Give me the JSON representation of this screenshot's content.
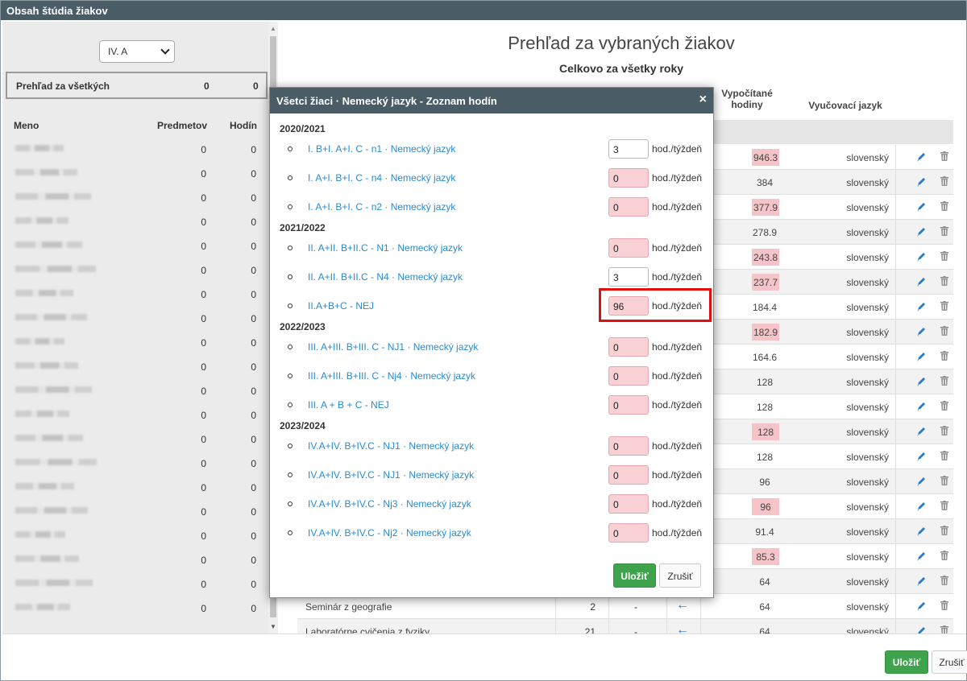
{
  "window": {
    "title": "Obsah štúdia žiakov"
  },
  "left": {
    "class_select": "IV. A",
    "overview_all": {
      "label": "Prehľad za všetkých",
      "subjects": "0",
      "hours": "0"
    },
    "headers": {
      "name": "Meno",
      "subjects": "Predmetov",
      "hours": "Hodín"
    },
    "rows": [
      {
        "subjects": "0",
        "hours": "0"
      },
      {
        "subjects": "0",
        "hours": "0"
      },
      {
        "subjects": "0",
        "hours": "0"
      },
      {
        "subjects": "0",
        "hours": "0"
      },
      {
        "subjects": "0",
        "hours": "0"
      },
      {
        "subjects": "0",
        "hours": "0"
      },
      {
        "subjects": "0",
        "hours": "0"
      },
      {
        "subjects": "0",
        "hours": "0"
      },
      {
        "subjects": "0",
        "hours": "0"
      },
      {
        "subjects": "0",
        "hours": "0"
      },
      {
        "subjects": "0",
        "hours": "0"
      },
      {
        "subjects": "0",
        "hours": "0"
      },
      {
        "subjects": "0",
        "hours": "0"
      },
      {
        "subjects": "0",
        "hours": "0"
      },
      {
        "subjects": "0",
        "hours": "0"
      },
      {
        "subjects": "0",
        "hours": "0"
      },
      {
        "subjects": "0",
        "hours": "0"
      },
      {
        "subjects": "0",
        "hours": "0"
      },
      {
        "subjects": "0",
        "hours": "0"
      },
      {
        "subjects": "0",
        "hours": "0"
      }
    ]
  },
  "main": {
    "title": "Prehľad za vybraných žiakov",
    "subtitle": "Celkovo za všetky roky",
    "headers": {
      "computed_hours": "Vypočítané hodiny",
      "language": "Vyučovací jazyk"
    },
    "rows": [
      {
        "hours": "946.3",
        "pink": true,
        "lang": "slovenský"
      },
      {
        "hours": "384",
        "pink": false,
        "lang": "slovenský"
      },
      {
        "hours": "377.9",
        "pink": true,
        "lang": "slovenský"
      },
      {
        "hours": "278.9",
        "pink": false,
        "lang": "slovenský"
      },
      {
        "hours": "243.8",
        "pink": true,
        "lang": "slovenský"
      },
      {
        "hours": "237.7",
        "pink": true,
        "lang": "slovenský"
      },
      {
        "hours": "184.4",
        "pink": false,
        "lang": "slovenský"
      },
      {
        "hours": "182.9",
        "pink": true,
        "lang": "slovenský"
      },
      {
        "hours": "164.6",
        "pink": false,
        "lang": "slovenský"
      },
      {
        "hours": "128",
        "pink": false,
        "lang": "slovenský"
      },
      {
        "hours": "128",
        "pink": false,
        "lang": "slovenský"
      },
      {
        "hours": "128",
        "pink": true,
        "lang": "slovenský"
      },
      {
        "hours": "128",
        "pink": false,
        "lang": "slovenský"
      },
      {
        "hours": "96",
        "pink": false,
        "lang": "slovenský"
      },
      {
        "hours": "96",
        "pink": true,
        "lang": "slovenský"
      },
      {
        "hours": "91.4",
        "pink": false,
        "lang": "slovenský"
      },
      {
        "hours": "85.3",
        "pink": true,
        "lang": "slovenský"
      },
      {
        "hours": "64",
        "pink": false,
        "lang": "slovenský"
      },
      {
        "name": "Seminár z geografie",
        "count": "2",
        "dash": "-",
        "hours": "64",
        "pink": false,
        "lang": "slovenský"
      },
      {
        "name": "Laboratórne cvičenia z fyziky",
        "count": "21",
        "dash": "-",
        "hours": "64",
        "pink": false,
        "lang": "slovenský"
      }
    ],
    "save": "Uložiť",
    "cancel": "Zrušiť"
  },
  "modal": {
    "title": "Všetci žiaci · Nemecký jazyk - Zoznam hodín",
    "close": "×",
    "unit": "hod./týždeň",
    "groups": [
      {
        "year": "2020/2021",
        "items": [
          {
            "label": "I. B+I. A+I. C - n1 · Nemecký jazyk",
            "value": "3",
            "pink": false
          },
          {
            "label": "I. A+I. B+I. C - n4 · Nemecký jazyk",
            "value": "0",
            "pink": true
          },
          {
            "label": "I. A+I. B+I. C - n2 · Nemecký jazyk",
            "value": "0",
            "pink": true
          }
        ]
      },
      {
        "year": "2021/2022",
        "items": [
          {
            "label": "II. A+II. B+II.C - N1 · Nemecký jazyk",
            "value": "0",
            "pink": true
          },
          {
            "label": "II. A+II. B+II.C - N4 · Nemecký jazyk",
            "value": "3",
            "pink": false
          },
          {
            "label": "II.A+B+C - NEJ",
            "value": "96",
            "pink": true
          }
        ]
      },
      {
        "year": "2022/2023",
        "items": [
          {
            "label": "III. A+III. B+III. C - NJ1 · Nemecký jazyk",
            "value": "0",
            "pink": true
          },
          {
            "label": "III. A+III. B+III. C - Nj4 · Nemecký jazyk",
            "value": "0",
            "pink": true
          },
          {
            "label": "III. A + B + C - NEJ",
            "value": "0",
            "pink": true
          }
        ]
      },
      {
        "year": "2023/2024",
        "items": [
          {
            "label": "IV.A+IV. B+IV.C - NJ1 · Nemecký jazyk",
            "value": "0",
            "pink": true
          },
          {
            "label": "IV.A+IV. B+IV.C - NJ1 · Nemecký jazyk",
            "value": "0",
            "pink": true
          },
          {
            "label": "IV.A+IV. B+IV.C - Nj3 · Nemecký jazyk",
            "value": "0",
            "pink": true
          },
          {
            "label": "IV.A+IV. B+IV.C - Nj2 · Nemecký jazyk",
            "value": "0",
            "pink": true
          }
        ]
      }
    ],
    "save": "Uložiť",
    "cancel": "Zrušiť"
  },
  "colors": {
    "header_bg": "#4a5d66",
    "link": "#2a8ad0",
    "save_green": "#3fa34d",
    "pink": "#f9d0d4",
    "highlight": "#e01010"
  }
}
